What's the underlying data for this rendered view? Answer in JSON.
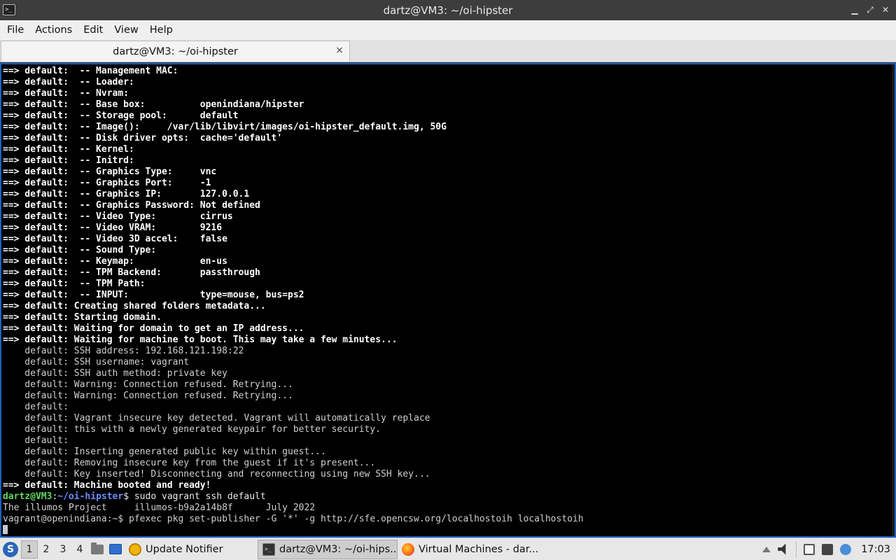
{
  "window": {
    "title": "dartz@VM3: ~/oi-hipster",
    "controls": [
      "minimize",
      "restore",
      "close"
    ]
  },
  "menubar": {
    "items": [
      "File",
      "Actions",
      "Edit",
      "View",
      "Help"
    ]
  },
  "tabs": [
    {
      "label": "dartz@VM3: ~/oi-hipster",
      "close": "×"
    }
  ],
  "terminal": {
    "lines": [
      {
        "style": "bold",
        "text": "==> default:  -- Management MAC:"
      },
      {
        "style": "bold",
        "text": "==> default:  -- Loader:"
      },
      {
        "style": "bold",
        "text": "==> default:  -- Nvram:"
      },
      {
        "style": "bold",
        "text": "==> default:  -- Base box:          openindiana/hipster"
      },
      {
        "style": "bold",
        "text": "==> default:  -- Storage pool:      default"
      },
      {
        "style": "bold",
        "text": "==> default:  -- Image():     /var/lib/libvirt/images/oi-hipster_default.img, 50G"
      },
      {
        "style": "bold",
        "text": "==> default:  -- Disk driver opts:  cache='default'"
      },
      {
        "style": "bold",
        "text": "==> default:  -- Kernel:"
      },
      {
        "style": "bold",
        "text": "==> default:  -- Initrd:"
      },
      {
        "style": "bold",
        "text": "==> default:  -- Graphics Type:     vnc"
      },
      {
        "style": "bold",
        "text": "==> default:  -- Graphics Port:     -1"
      },
      {
        "style": "bold",
        "text": "==> default:  -- Graphics IP:       127.0.0.1"
      },
      {
        "style": "bold",
        "text": "==> default:  -- Graphics Password: Not defined"
      },
      {
        "style": "bold",
        "text": "==> default:  -- Video Type:        cirrus"
      },
      {
        "style": "bold",
        "text": "==> default:  -- Video VRAM:        9216"
      },
      {
        "style": "bold",
        "text": "==> default:  -- Video 3D accel:    false"
      },
      {
        "style": "bold",
        "text": "==> default:  -- Sound Type:"
      },
      {
        "style": "bold",
        "text": "==> default:  -- Keymap:            en-us"
      },
      {
        "style": "bold",
        "text": "==> default:  -- TPM Backend:       passthrough"
      },
      {
        "style": "bold",
        "text": "==> default:  -- TPM Path:"
      },
      {
        "style": "bold",
        "text": "==> default:  -- INPUT:             type=mouse, bus=ps2"
      },
      {
        "style": "bold",
        "text": "==> default: Creating shared folders metadata..."
      },
      {
        "style": "bold",
        "text": "==> default: Starting domain."
      },
      {
        "style": "bold",
        "text": "==> default: Waiting for domain to get an IP address..."
      },
      {
        "style": "bold",
        "text": "==> default: Waiting for machine to boot. This may take a few minutes..."
      },
      {
        "style": "plain",
        "text": "    default: SSH address: 192.168.121.198:22"
      },
      {
        "style": "plain",
        "text": "    default: SSH username: vagrant"
      },
      {
        "style": "plain",
        "text": "    default: SSH auth method: private key"
      },
      {
        "style": "plain",
        "text": "    default: Warning: Connection refused. Retrying..."
      },
      {
        "style": "plain",
        "text": "    default: Warning: Connection refused. Retrying..."
      },
      {
        "style": "plain",
        "text": "    default:"
      },
      {
        "style": "plain",
        "text": "    default: Vagrant insecure key detected. Vagrant will automatically replace"
      },
      {
        "style": "plain",
        "text": "    default: this with a newly generated keypair for better security."
      },
      {
        "style": "plain",
        "text": "    default:"
      },
      {
        "style": "plain",
        "text": "    default: Inserting generated public key within guest..."
      },
      {
        "style": "plain",
        "text": "    default: Removing insecure key from the guest if it's present..."
      },
      {
        "style": "plain",
        "text": "    default: Key inserted! Disconnecting and reconnecting using new SSH key..."
      },
      {
        "style": "bold",
        "text": "==> default: Machine booted and ready!"
      }
    ],
    "prompt": {
      "user_host": "dartz@VM3",
      "sep": ":",
      "path": "~/oi-hipster",
      "symbol": "$",
      "command": " sudo vagrant ssh default"
    },
    "motd": "The illumos Project     illumos-b9a2a14b8f      July 2022",
    "guest_prompt": "vagrant@openindiana:~$ pfexec pkg set-publisher -G '*' -g http://sfe.opencsw.org/localhostoih localhostoih"
  },
  "taskbar": {
    "desktops": [
      "1",
      "2",
      "3",
      "4"
    ],
    "active_desktop": "1",
    "tasks": [
      {
        "label": "Update Notifier",
        "icon": "update-notifier-icon"
      },
      {
        "label": "dartz@VM3: ~/oi-hips...",
        "icon": "terminal-icon",
        "active": true
      },
      {
        "label": "Virtual Machines - dar...",
        "icon": "firefox-icon"
      }
    ],
    "clock": "17:03"
  },
  "colors": {
    "terminal_bg": "#000000",
    "prompt_user": "#5fd75f",
    "prompt_path": "#6c8cff",
    "terminal_border": "#1f5fbf"
  }
}
